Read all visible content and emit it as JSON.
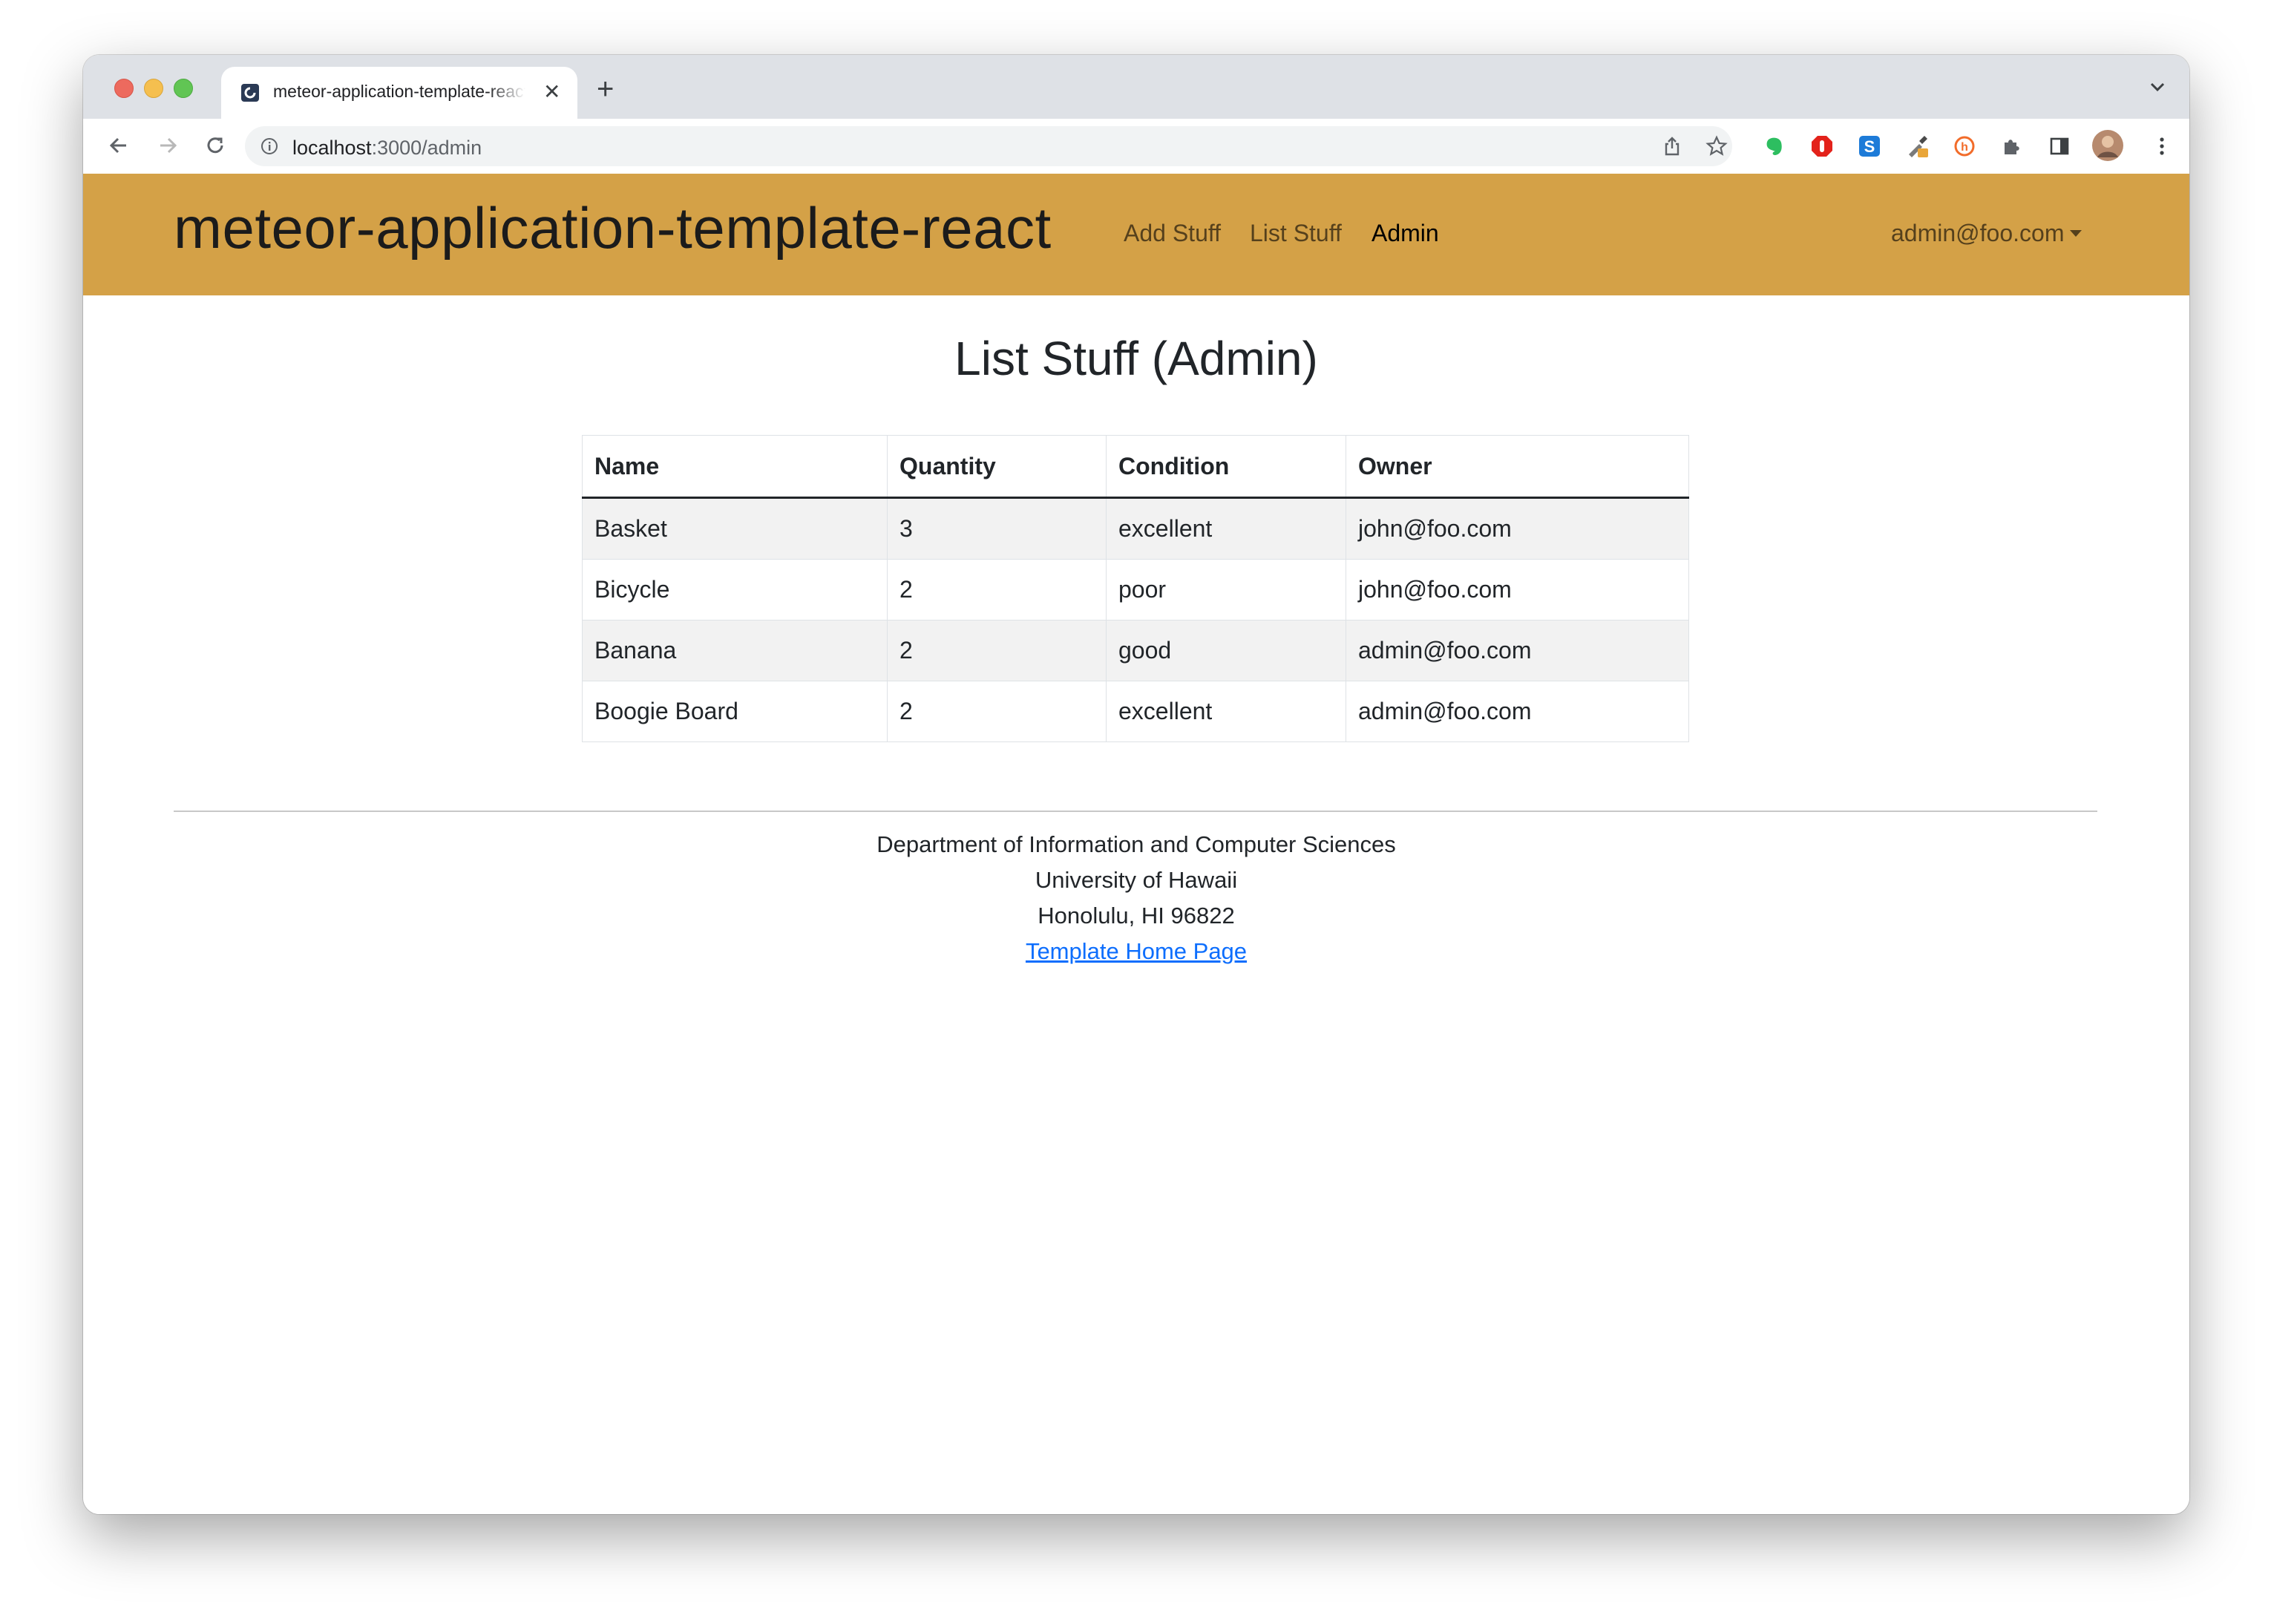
{
  "browser": {
    "tab_title": "meteor-application-template-react",
    "url_host": "localhost",
    "url_path": ":3000/admin",
    "new_tab_label": "+",
    "close_label": "✕"
  },
  "navbar": {
    "brand": "meteor-application-template-react",
    "links": [
      "Add Stuff",
      "List Stuff",
      "Admin"
    ],
    "active_link": "Admin",
    "user": "admin@foo.com",
    "color": "#d4a147"
  },
  "main": {
    "title": "List Stuff (Admin)",
    "table": {
      "headers": [
        "Name",
        "Quantity",
        "Condition",
        "Owner"
      ],
      "rows": [
        [
          "Basket",
          "3",
          "excellent",
          "john@foo.com"
        ],
        [
          "Bicycle",
          "2",
          "poor",
          "john@foo.com"
        ],
        [
          "Banana",
          "2",
          "good",
          "admin@foo.com"
        ],
        [
          "Boogie Board",
          "2",
          "excellent",
          "admin@foo.com"
        ]
      ]
    }
  },
  "footer": {
    "lines": [
      "Department of Information and Computer Sciences",
      "University of Hawaii",
      "Honolulu, HI 96822"
    ],
    "link": "Template Home Page",
    "link_color": "#0d6efd"
  }
}
